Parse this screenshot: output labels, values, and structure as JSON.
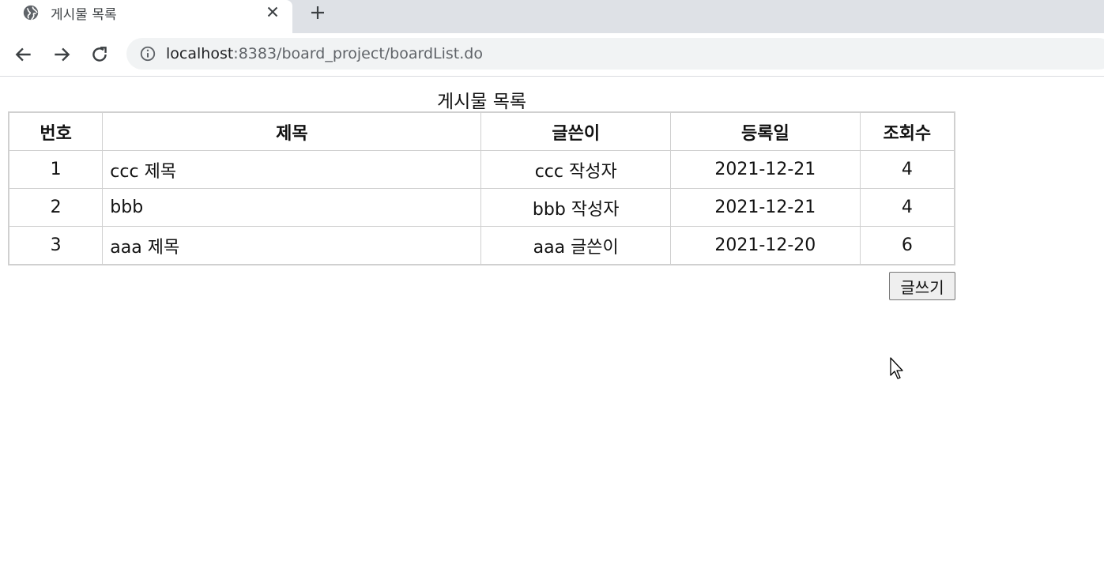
{
  "browser": {
    "tab_title": "게시물 목록",
    "url_host": "localhost",
    "url_rest": ":8383/board_project/boardList.do"
  },
  "page": {
    "title": "게시물 목록",
    "columns": [
      "번호",
      "제목",
      "글쓴이",
      "등록일",
      "조회수"
    ],
    "rows": [
      {
        "no": "1",
        "title": "ccc 제목",
        "writer": "ccc 작성자",
        "date": "2021-12-21",
        "views": "4"
      },
      {
        "no": "2",
        "title": "bbb",
        "writer": "bbb 작성자",
        "date": "2021-12-21",
        "views": "4"
      },
      {
        "no": "3",
        "title": "aaa 제목",
        "writer": "aaa 글쓴이",
        "date": "2021-12-20",
        "views": "6"
      }
    ],
    "write_button": "글쓰기"
  },
  "icons": {
    "tab_favicon": "globe-icon",
    "tab_close": "close-icon",
    "new_tab": "plus-icon",
    "back": "arrow-left-icon",
    "forward": "arrow-right-icon",
    "reload": "reload-icon",
    "site_info": "info-icon",
    "pointer": "cursor-icon"
  }
}
